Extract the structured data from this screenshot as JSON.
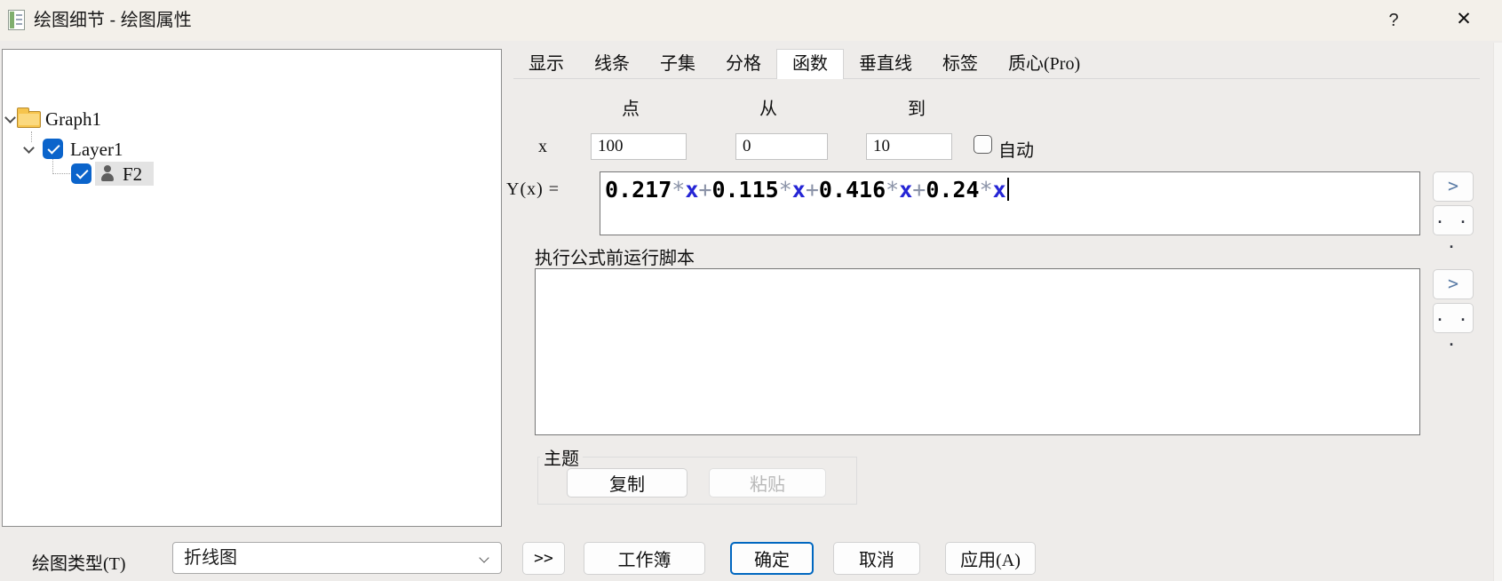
{
  "window": {
    "title": "绘图细节 - 绘图属性",
    "help_label": "?",
    "close_label": "✕"
  },
  "tree": {
    "root_label": "Graph1",
    "layer_label": "Layer1",
    "layer_checked": true,
    "dataset_label": "F2",
    "dataset_checked": true
  },
  "tabs": {
    "items": [
      "显示",
      "线条",
      "子集",
      "分格",
      "函数",
      "垂直线",
      "标签",
      "质心(Pro)"
    ],
    "active_index": 4
  },
  "function_panel": {
    "columns": {
      "points": "点",
      "from": "从",
      "to": "到"
    },
    "x_row": {
      "label": "x",
      "points_value": "100",
      "from_value": "0",
      "to_value": "10",
      "auto_label": "自动",
      "auto_checked": false
    },
    "y_label": "Y(x) =",
    "formula": "0.217*x+0.115*x+0.416*x+0.24*x",
    "formula_tokens": [
      {
        "text": "0.217",
        "type": "num"
      },
      {
        "text": "*",
        "type": "op"
      },
      {
        "text": "x",
        "type": "var"
      },
      {
        "text": "+",
        "type": "plus"
      },
      {
        "text": "0.115",
        "type": "num"
      },
      {
        "text": "*",
        "type": "op"
      },
      {
        "text": "x",
        "type": "var"
      },
      {
        "text": "+",
        "type": "plus"
      },
      {
        "text": "0.416",
        "type": "num"
      },
      {
        "text": "*",
        "type": "op"
      },
      {
        "text": "x",
        "type": "var"
      },
      {
        "text": "+",
        "type": "plus"
      },
      {
        "text": "0.24",
        "type": "num"
      },
      {
        "text": "*",
        "type": "op"
      },
      {
        "text": "x",
        "type": "var"
      }
    ],
    "expand_button": ">",
    "more_button": ". . .",
    "script_label": "执行公式前运行脚本",
    "script_value": "",
    "theme": {
      "title": "主题",
      "copy_label": "复制",
      "paste_label": "粘贴",
      "paste_enabled": false
    }
  },
  "footer": {
    "plot_type_label": "绘图类型(T)",
    "plot_type_value": "折线图",
    "expand_label": ">>",
    "workbook_label": "工作簿",
    "ok_label": "确定",
    "cancel_label": "取消",
    "apply_label": "应用(A)"
  },
  "colors": {
    "accent_checkbox_blue": "#0b64cb",
    "ok_button_border": "#0067c0",
    "token_number": "#000000",
    "token_operator": "#8b93a8",
    "token_variable": "#2525d5",
    "folder_yellow": "#f6c44c"
  }
}
